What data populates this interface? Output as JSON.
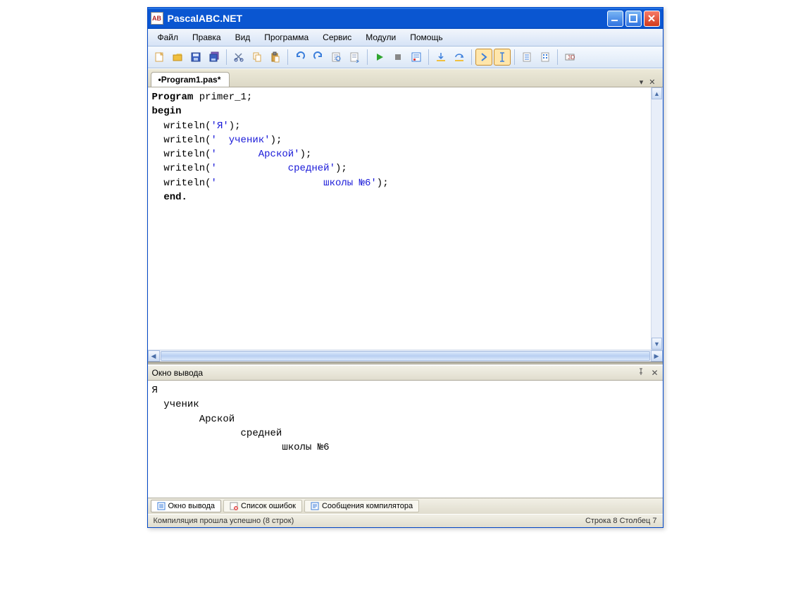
{
  "title": "PascalABC.NET",
  "menu": [
    "Файл",
    "Правка",
    "Вид",
    "Программа",
    "Сервис",
    "Модули",
    "Помощь"
  ],
  "tab": "•Program1.pas*",
  "tabrow": {
    "dropdown": "▾",
    "close": "✕"
  },
  "code": {
    "line1": {
      "kw": "Program",
      "rest": " primer_1;"
    },
    "line2": "begin",
    "writeln": "writeln",
    "paren_open": "(",
    "paren_close": ")",
    "semi": ";",
    "quote": "'",
    "s1": "Я",
    "s2": "  ученик",
    "s3": "       Арской",
    "s4": "            средней",
    "s5": "                  школы №6",
    "end": "end."
  },
  "output_panel": {
    "title": "Окно вывода",
    "pin": "📌",
    "close": "✕",
    "lines": [
      "Я",
      "  ученик",
      "        Арской",
      "               средней",
      "                      школы №6"
    ]
  },
  "bottom_tabs": {
    "t1": "Окно вывода",
    "t2": "Список ошибок",
    "t3": "Сообщения компилятора"
  },
  "status": {
    "compile": "Компиляция прошла успешно (8 строк)",
    "pos": "Строка  8  Столбец  7"
  },
  "icons": {
    "new": "📄",
    "open": "📂",
    "save": "💾",
    "saveall": "💾",
    "cut": "✂",
    "copy": "📑",
    "paste": "📋",
    "undo": "↶",
    "redo": "↷",
    "find": "🔍",
    "replace": "🔎",
    "run": "▶",
    "stop": "■",
    "stepinto": "📅",
    "stepover": "⤵",
    "stepout": "⤴",
    "br1": "▷",
    "br2": "I",
    "opt1": "≡",
    "opt2": "▤",
    "opt3": "⚙"
  }
}
